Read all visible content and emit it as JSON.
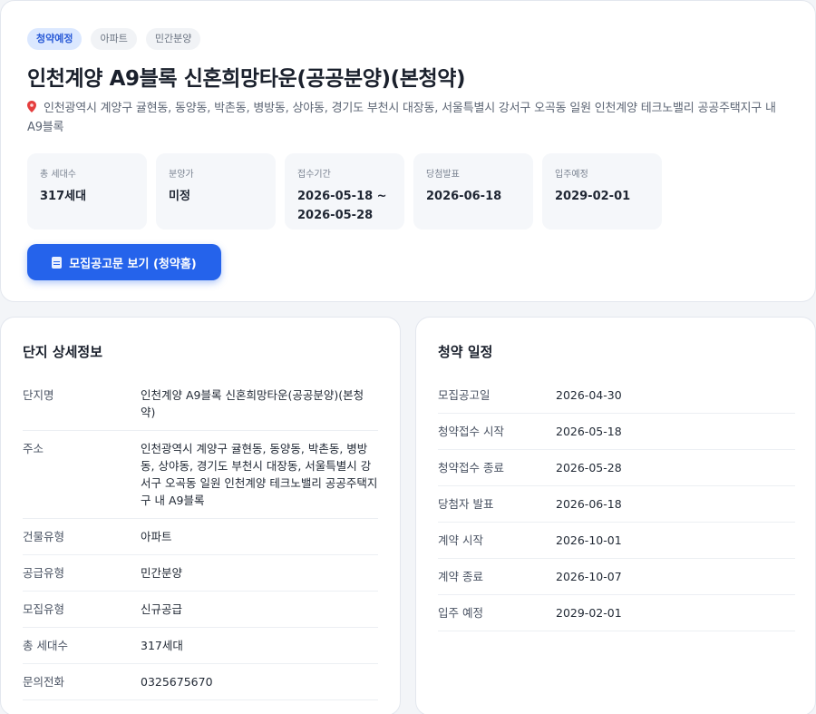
{
  "hero": {
    "tags": [
      "청약예정",
      "아파트",
      "민간분양"
    ],
    "title": "인천계양 A9블록 신혼희망타운(공공분양)(본청약)",
    "address_icon": "pin-icon",
    "address": "인천광역시 계양구 귤현동, 동양동, 박촌동, 병방동, 상야동, 경기도 부천시 대장동, 서울특별시 강서구 오곡동 일원 인천계양 테크노밸리 공공주택지구 내 A9블록",
    "stats": [
      {
        "label": "총 세대수",
        "value": "317세대"
      },
      {
        "label": "분양가",
        "value": "미정"
      },
      {
        "label": "접수기간",
        "value": "2026-05-18 ~ 2026-05-28"
      },
      {
        "label": "당첨발표",
        "value": "2026-06-18"
      },
      {
        "label": "입주예정",
        "value": "2029-02-01"
      }
    ],
    "button_label": "모집공고문 보기 (청약홈)",
    "button_icon": "document-icon",
    "accent_color": "#2563eb"
  },
  "detail": {
    "title": "단지 상세정보",
    "rows": [
      {
        "label": "단지명",
        "value": "인천계양 A9블록 신혼희망타운(공공분양)(본청약)"
      },
      {
        "label": "주소",
        "value": "인천광역시 계양구 귤현동, 동양동, 박촌동, 병방동, 상야동, 경기도 부천시 대장동, 서울특별시 강서구 오곡동 일원 인천계양 테크노밸리 공공주택지구 내 A9블록"
      },
      {
        "label": "건물유형",
        "value": "아파트"
      },
      {
        "label": "공급유형",
        "value": "민간분양"
      },
      {
        "label": "모집유형",
        "value": "신규공급"
      },
      {
        "label": "총 세대수",
        "value": "317세대"
      },
      {
        "label": "문의전화",
        "value": "0325675670"
      }
    ]
  },
  "schedule": {
    "title": "청약 일정",
    "rows": [
      {
        "label": "모집공고일",
        "value": "2026-04-30"
      },
      {
        "label": "청약접수 시작",
        "value": "2026-05-18"
      },
      {
        "label": "청약접수 종료",
        "value": "2026-05-28"
      },
      {
        "label": "당첨자 발표",
        "value": "2026-06-18"
      },
      {
        "label": "계약 시작",
        "value": "2026-10-01"
      },
      {
        "label": "계약 종료",
        "value": "2026-10-07"
      },
      {
        "label": "입주 예정",
        "value": "2029-02-01"
      }
    ]
  }
}
